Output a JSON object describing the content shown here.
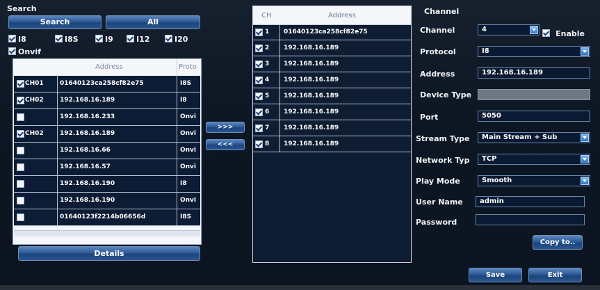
{
  "search": {
    "title": "Search",
    "search_button": "Search",
    "all_button": "All",
    "protocols": [
      {
        "label": "I8",
        "checked": true
      },
      {
        "label": "I8S",
        "checked": true
      },
      {
        "label": "I9",
        "checked": true
      },
      {
        "label": "I12",
        "checked": true
      },
      {
        "label": "I20",
        "checked": true
      },
      {
        "label": "Onvif",
        "checked": true
      }
    ],
    "columns": {
      "address": "Address",
      "protocol": "Proto"
    },
    "rows": [
      {
        "checked": true,
        "ch": "CH01",
        "address": "01640123ca258cf82e75",
        "protocol": "I8S"
      },
      {
        "checked": true,
        "ch": "CH02",
        "address": "192.168.16.189",
        "protocol": "I8"
      },
      {
        "checked": false,
        "ch": "",
        "address": "192.168.16.233",
        "protocol": "Onvi"
      },
      {
        "checked": true,
        "ch": "CH02",
        "address": "192.168.16.189",
        "protocol": "Onvi"
      },
      {
        "checked": false,
        "ch": "",
        "address": "192.168.16.66",
        "protocol": "Onvi"
      },
      {
        "checked": false,
        "ch": "",
        "address": "192.168.16.57",
        "protocol": "Onvi"
      },
      {
        "checked": false,
        "ch": "",
        "address": "192.168.16.190",
        "protocol": "I8"
      },
      {
        "checked": false,
        "ch": "",
        "address": "192.168.16.190",
        "protocol": "Onvi"
      },
      {
        "checked": false,
        "ch": "",
        "address": "01640123f2214b06656d",
        "protocol": "I8S"
      }
    ],
    "details_button": "Details"
  },
  "transfer": {
    "add_label": ">>>",
    "remove_label": "<<<"
  },
  "channels": {
    "columns": {
      "ch": "CH",
      "address": "Address"
    },
    "rows": [
      {
        "checked": true,
        "ch": "1",
        "address": "01640123ca258cf82e75"
      },
      {
        "checked": true,
        "ch": "2",
        "address": "192.168.16.189"
      },
      {
        "checked": true,
        "ch": "3",
        "address": "192.168.16.189"
      },
      {
        "checked": true,
        "ch": "4",
        "address": "192.168.16.189"
      },
      {
        "checked": true,
        "ch": "5",
        "address": "192.168.16.189"
      },
      {
        "checked": true,
        "ch": "6",
        "address": "192.168.16.189"
      },
      {
        "checked": true,
        "ch": "7",
        "address": "192.168.16.189"
      },
      {
        "checked": true,
        "ch": "8",
        "address": "192.168.16.189"
      }
    ]
  },
  "settings": {
    "title": "Channel",
    "channel_label": "Channel",
    "channel_value": "4",
    "enable_label": "Enable",
    "enable_checked": true,
    "protocol_label": "Protocol",
    "protocol_value": "I8",
    "address_label": "Address",
    "address_value": "192.168.16.189",
    "device_type_label": "Device Type",
    "device_type_value": "",
    "port_label": "Port",
    "port_value": "5050",
    "stream_type_label": "Stream Type",
    "stream_type_value": "Main Stream + Sub",
    "network_type_label": "Network Typ",
    "network_type_value": "TCP",
    "play_mode_label": "Play Mode",
    "play_mode_value": "Smooth",
    "user_name_label": "User Name",
    "user_name_value": "admin",
    "password_label": "Password",
    "password_value": "",
    "copy_button": "Copy to..",
    "save_button": "Save",
    "exit_button": "Exit"
  },
  "colors": {
    "background": "#0c1420",
    "button_blue": "#2e5a96",
    "field_blue": "#0b1a33",
    "list_panel": "#0f1d33"
  }
}
